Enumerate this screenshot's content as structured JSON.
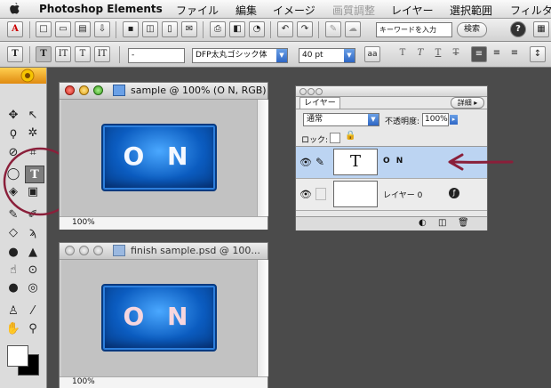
{
  "menubar": {
    "app_name": "Photoshop Elements",
    "items": [
      "ファイル",
      "編集",
      "イメージ",
      "画質調整",
      "レイヤー",
      "選択範囲",
      "フィルタ"
    ]
  },
  "toolbar1": {
    "search_placeholder": "キーワードを入力",
    "search_button": "検索"
  },
  "toolbar2": {
    "font_style": "-",
    "font_name": "DFP太丸ゴシック体",
    "font_size": "40 pt",
    "aa_label": "aa"
  },
  "toolbox": {
    "selected_tool_label": "T"
  },
  "documents": [
    {
      "title": "sample @ 100% (O N, RGB)",
      "zoom": "100%",
      "button_text": "O N"
    },
    {
      "title": "finish sample.psd @ 100...",
      "zoom": "100%",
      "button_text": "O N"
    }
  ],
  "layers_panel": {
    "tab_label": "レイヤー",
    "more_button": "詳細",
    "blend_mode": "通常",
    "opacity_label": "不透明度:",
    "opacity_value": "100%",
    "lock_label": "ロック:",
    "layers": [
      {
        "name": "O N",
        "thumb": "T",
        "selected": true
      },
      {
        "name": "レイヤー 0",
        "thumb": "",
        "selected": false
      }
    ]
  },
  "colors": {
    "desktop": "#4b4b4b",
    "annotation": "#8a1f3a",
    "selected_layer": "#bcd4f2",
    "on_button": "#0b5cc0"
  }
}
